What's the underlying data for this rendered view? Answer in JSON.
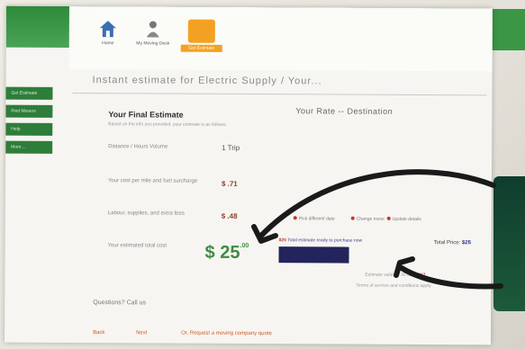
{
  "nav": {
    "items": [
      {
        "label": "Home"
      },
      {
        "label": "My Moving Desk"
      },
      {
        "label": "Get Estimate"
      }
    ]
  },
  "page_title": "Instant estimate for Electric Supply / Your...",
  "sidebar": {
    "items": [
      {
        "label": "Get Estimate"
      },
      {
        "label": "Find Movers"
      },
      {
        "label": "Help"
      },
      {
        "label": "More  ..."
      }
    ]
  },
  "estimate": {
    "title": "Your Final Estimate",
    "subtitle": "Based on the info you provided, your estimate is as follows:",
    "rows": [
      {
        "label": "Distance / Hours Volume",
        "value": "1 Trip"
      },
      {
        "label": "Your cost per mile and fuel surcharge",
        "value": "$ .71"
      },
      {
        "label": "Labour, supplies, and extra fees",
        "value": "$ .48"
      },
      {
        "label": "Your estimated total cost",
        "value": "$ 25"
      }
    ],
    "big_price_cents": ".00"
  },
  "destination": {
    "title": "Your Rate -- Destination",
    "options": [
      "Pick different date",
      "Change move",
      "Update details"
    ]
  },
  "purchase": {
    "line_prefix": "$25",
    "line_text": " Total estimate ready to purchase now",
    "total_label": "Total Price: ",
    "total_value": "$25",
    "note1_text": "Estimate valid for 30 days ",
    "note1_value": "$17",
    "note2_text": "Terms of service and conditions apply"
  },
  "questions": "Questions? Call us",
  "bottom_links": [
    "Back",
    "Next",
    "Or, Request a moving company quote"
  ],
  "colors": {
    "green_header": "#3b9646",
    "accent_orange": "#f3a122",
    "price_green": "#3f8b45",
    "button_navy": "#23245c"
  }
}
